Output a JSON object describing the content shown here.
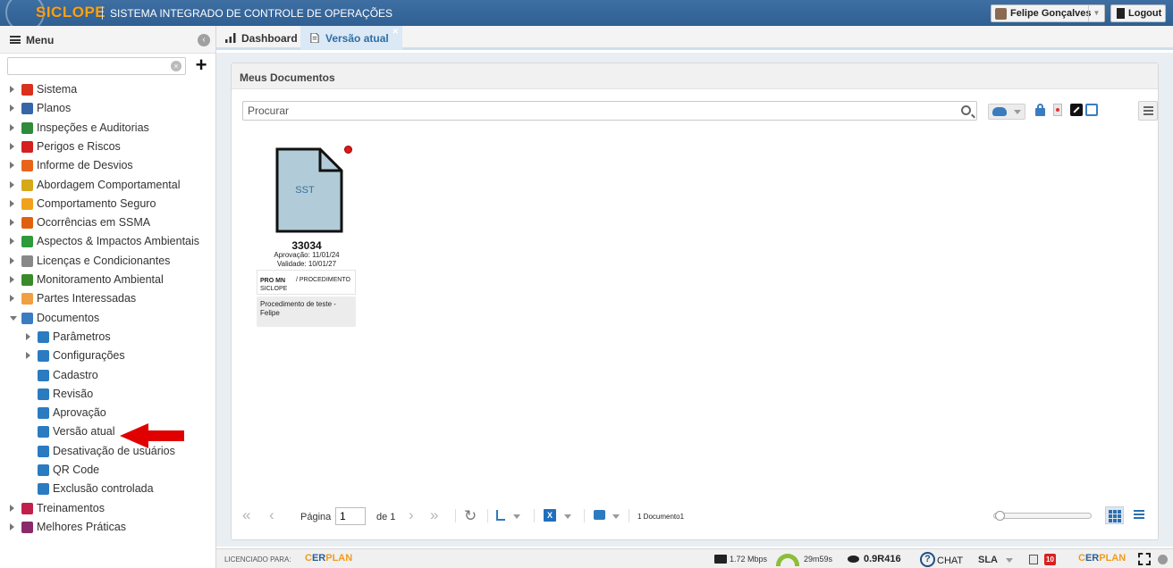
{
  "header": {
    "brand": "SICLOPE",
    "system_title": "SISTEMA INTEGRADO DE CONTROLE DE OPERAÇÕES",
    "user_name": "Felipe Gonçalves",
    "logout_label": "Logout"
  },
  "sidebar": {
    "title": "Menu",
    "search_value": "",
    "items": [
      {
        "label": "Sistema",
        "icon": "gear-red-icon",
        "color": "#d9311c"
      },
      {
        "label": "Planos",
        "icon": "calendar-icon",
        "color": "#3466a8"
      },
      {
        "label": "Inspeções e Auditorias",
        "icon": "checklist-icon",
        "color": "#2e8b3a"
      },
      {
        "label": "Perigos e Riscos",
        "icon": "warning-icon",
        "color": "#d32020"
      },
      {
        "label": "Informe de Desvios",
        "icon": "phone-icon",
        "color": "#e8641a"
      },
      {
        "label": "Abordagem Comportamental",
        "icon": "diamond-sign-icon",
        "color": "#d6a81a"
      },
      {
        "label": "Comportamento Seguro",
        "icon": "helmet-icon",
        "color": "#f0a21a"
      },
      {
        "label": "Ocorrências em SSMA",
        "icon": "falling-person-icon",
        "color": "#e06010"
      },
      {
        "label": "Aspectos & Impactos Ambientais",
        "icon": "recycle-icon",
        "color": "#2e9a3a"
      },
      {
        "label": "Licenças e Condicionantes",
        "icon": "certificate-icon",
        "color": "#888888"
      },
      {
        "label": "Monitoramento Ambiental",
        "icon": "tree-icon",
        "color": "#3a8a2a"
      },
      {
        "label": "Partes Interessadas",
        "icon": "people-icon",
        "color": "#f0a040"
      },
      {
        "label": "Documentos",
        "icon": "folder-icon",
        "color": "#3a7cc2"
      }
    ],
    "documentos_children": [
      {
        "label": "Parâmetros",
        "icon": "settings-icon",
        "color": "#2b7bc1"
      },
      {
        "label": "Configurações",
        "icon": "sliders-icon",
        "color": "#2b7bc1"
      },
      {
        "label": "Cadastro",
        "icon": "edit-document-icon",
        "color": "#2b7bc1"
      },
      {
        "label": "Revisão",
        "icon": "thumbs-up-icon",
        "color": "#2b7bc1"
      },
      {
        "label": "Aprovação",
        "icon": "approval-document-icon",
        "color": "#2b7bc1"
      },
      {
        "label": "Versão atual",
        "icon": "document-icon",
        "color": "#2b7bc1"
      },
      {
        "label": "Desativação de usuários",
        "icon": "users-icon",
        "color": "#2b7bc1"
      },
      {
        "label": "QR Code",
        "icon": "qr-code-icon",
        "color": "#2b7bc1"
      },
      {
        "label": "Exclusão controlada",
        "icon": "trash-icon",
        "color": "#2b7bc1"
      }
    ],
    "after_items": [
      {
        "label": "Treinamentos",
        "icon": "trainer-icon",
        "color": "#c0204a"
      },
      {
        "label": "Melhores Práticas",
        "icon": "award-icon",
        "color": "#8a2a6a"
      }
    ]
  },
  "tabs": [
    {
      "label": "Dashboard",
      "icon": "bar-chart-icon"
    },
    {
      "label": "Versão atual",
      "icon": "document-icon",
      "active": true
    }
  ],
  "panel": {
    "title": "Meus Documentos",
    "search_placeholder": "Procurar"
  },
  "document": {
    "file_label": "SST",
    "number": "33034",
    "approval": "Aprovação: 11/01/24",
    "validity": "Validade: 10/01/27",
    "code_line1": "PRO MN",
    "code_line2": "SICLOPE",
    "type": "/ PROCEDIMENTO",
    "description": "Procedimento de teste - Felipe"
  },
  "pager": {
    "page_label": "Página",
    "page_value": "1",
    "of_label": "de 1",
    "count_label": "1 Documento1",
    "zoom_fraction": 0.0
  },
  "footer": {
    "licensed_label": "LICENCIADO PARA:",
    "vendor_er": "ER",
    "vendor_plan": "PLAN",
    "network_speed": "1.72 Mbps",
    "session_timer": "29m59s",
    "version": "0.9R416",
    "chat_label": "CHAT",
    "sla_label": "SLA",
    "badge_count": "10"
  },
  "colors": {
    "header_bg": "#2f5f93",
    "brand": "#f6a21a",
    "active_tab": "#dbe8f5",
    "file_fill": "#b1ccd8",
    "status_dot": "#e01818",
    "arrow": "#e00000"
  }
}
